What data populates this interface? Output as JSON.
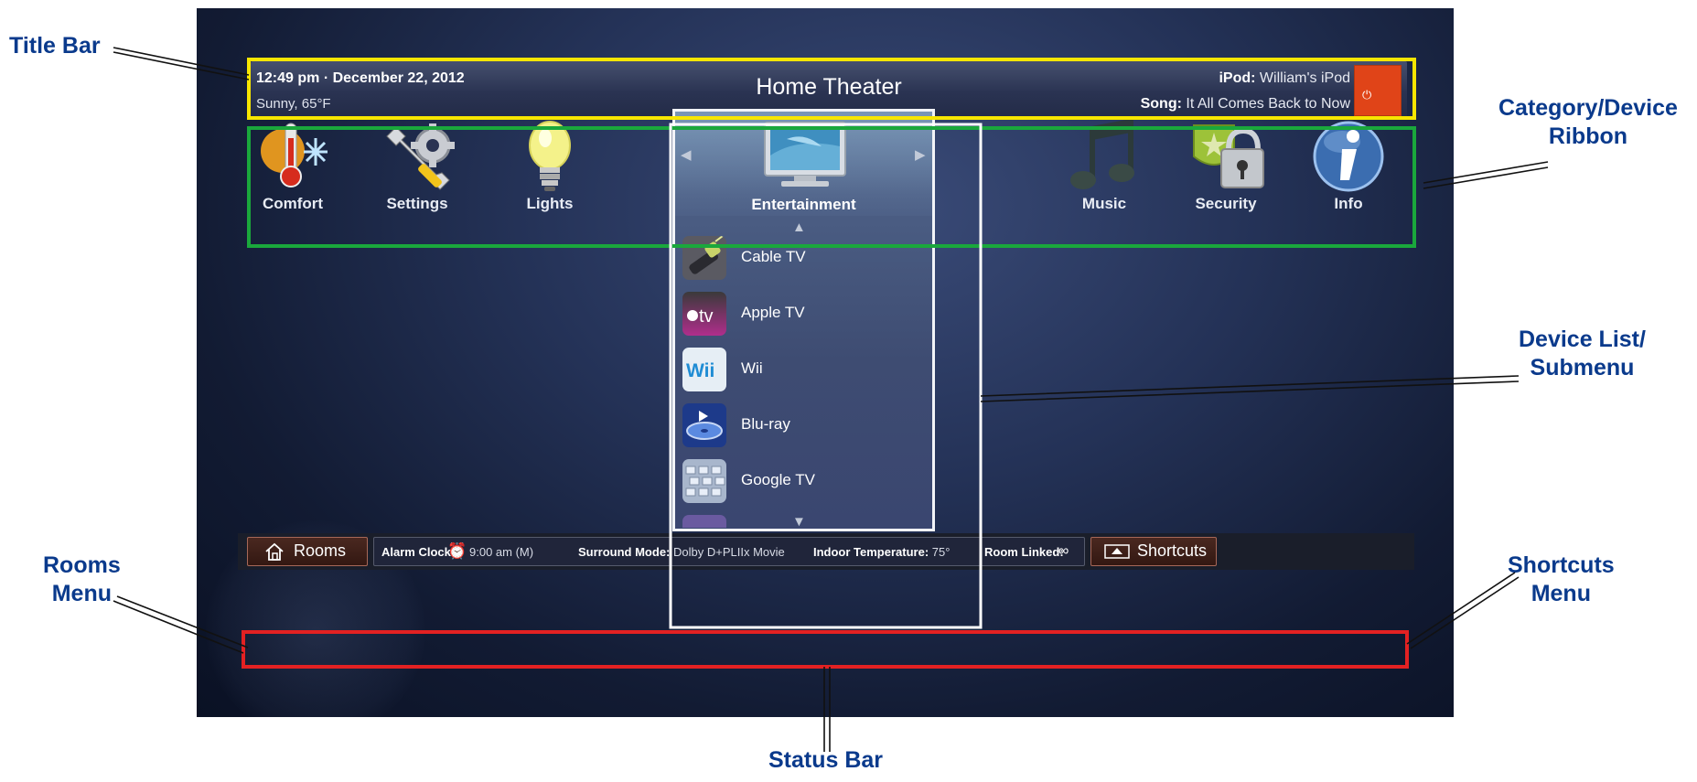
{
  "colors": {
    "title_bar_outline": "#f7e600",
    "ribbon_outline": "#1aa83c",
    "status_bar_outline": "#e32122",
    "annotation_text": "#0a3a8c"
  },
  "annotations": {
    "title_bar": "Title Bar",
    "category_ribbon_1": "Category/Device",
    "category_ribbon_2": "Ribbon",
    "device_list_1": "Device List/",
    "device_list_2": "Submenu",
    "rooms_menu_1": "Rooms",
    "rooms_menu_2": "Menu",
    "shortcuts_menu_1": "Shortcuts",
    "shortcuts_menu_2": "Menu",
    "status_bar": "Status Bar"
  },
  "title_bar": {
    "time_date": "12:49 pm · December 22, 2012",
    "weather": "Sunny, 65°F",
    "title": "Home Theater",
    "ipod_label": "iPod:",
    "ipod_value": " William's iPod",
    "song_label": "Song:",
    "song_value": " It All Comes Back to Now"
  },
  "ribbon": {
    "items": [
      {
        "label": "Comfort",
        "icon": "thermometer-snowflake-icon"
      },
      {
        "label": "Settings",
        "icon": "wrench-gear-icon"
      },
      {
        "label": "Lights",
        "icon": "light-bulb-icon"
      },
      {
        "label": "Entertainment",
        "icon": "television-icon",
        "selected": true
      },
      {
        "label": "Music",
        "icon": "music-notes-icon"
      },
      {
        "label": "Security",
        "icon": "shield-padlock-icon"
      },
      {
        "label": "Info",
        "icon": "info-icon"
      }
    ]
  },
  "device_list": {
    "items": [
      {
        "label": "Cable TV",
        "icon": "cable-connector-icon"
      },
      {
        "label": "Apple TV",
        "icon": "apple-tv-icon",
        "icon_text": "tv"
      },
      {
        "label": "Wii",
        "icon": "wii-icon",
        "icon_text": "Wii"
      },
      {
        "label": "Blu-ray",
        "icon": "blu-ray-disc-icon"
      },
      {
        "label": "Google TV",
        "icon": "google-tv-keyboard-icon"
      }
    ]
  },
  "status_bar": {
    "rooms_label": "Rooms",
    "alarm_label": "Alarm Clock:",
    "alarm_value": "9:00 am (M)",
    "surround_label": "Surround Mode:",
    "surround_value": "Dolby D+PLIIx Movie",
    "temp_label": "Indoor Temperature:",
    "temp_value": "75°",
    "room_linked_label": "Room Linked:",
    "shortcuts_label": "Shortcuts"
  }
}
